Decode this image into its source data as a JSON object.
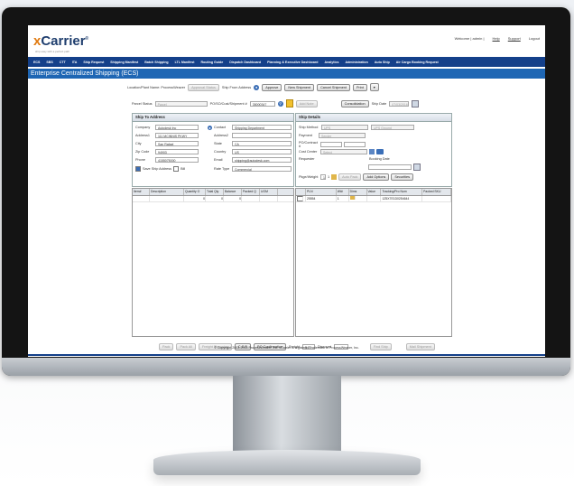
{
  "header": {
    "brand": "xCarrier",
    "reg": "®",
    "tagline": "ship easy with a perfect path",
    "links": [
      "Welcome | admin |",
      "Help",
      "Support",
      "Logout"
    ]
  },
  "nav": [
    "ECS",
    "SBS",
    "CTT",
    "ITA",
    "Ship Request",
    "Shipping Manifest",
    "Batch Shipping",
    "LTL Manifest",
    "Routing Guide",
    "Dispatch Dashboard",
    "Planning & Executive Dashboard",
    "Analytics",
    "Administration",
    "Auto Ship",
    "Air Cargo Booking Request"
  ],
  "page_title": "Enterprise Centralized Shipping (ECS)",
  "toolbar": {
    "location_label": "Location/Plant Name: ProcessWeaver",
    "approval_status": "Approval Status",
    "ship_from_label": "Ship From Address",
    "approve": "Approve",
    "new_shipment": "New Shipment",
    "cancel_shipment": "Cancel Shipment",
    "print": "Print"
  },
  "search_row": {
    "parcel_status_label": "Parcel Status",
    "parcel_status_value": "Parcel",
    "po_label": "PO/SO/Cust/Shipment #",
    "po_value": "35000347",
    "add_note": "Add Note",
    "consolidation": "Consolidation",
    "ship_date_label": "Ship Date",
    "ship_date_value": "07/03/2016"
  },
  "ship_to": {
    "title": "Ship To Address",
    "company_label": "Company",
    "company": "Autodesk Inc",
    "contact_label": "Contact",
    "contact": "Shipping Department",
    "address1_label": "Address1",
    "address1": "111 MCINNIS PKWY",
    "address2_label": "Address2",
    "city_label": "City",
    "city": "San Rafael",
    "state_label": "State",
    "state": "CA",
    "zip_label": "Zip Code",
    "zip": "94903",
    "country_label": "Country",
    "country": "US",
    "phone_label": "Phone",
    "phone": "4155075000",
    "email_label": "Email",
    "email": "shipping@autodesk.com",
    "save_label": "Save Ship Address",
    "bill_label": "Bill",
    "rate_type_label": "Rate Type",
    "rate_type": "Commercial"
  },
  "ship_details": {
    "title": "Ship Details",
    "ship_method_label": "Ship Method",
    "ship_method": "UPS",
    "ship_via": "UPS Ground",
    "payment_label": "Payment",
    "payment": "Sender",
    "po_contract_label": "PO/Contract #",
    "cost_center_label": "Cost Center",
    "cost_center": "Select",
    "requester_label": "Requester",
    "booking_label": "Booking Date",
    "pkgs_label": "Pkge/Weight",
    "pkgs": "1",
    "of": "1",
    "auto_pack": "Auto Pack",
    "add_options": "Add Options",
    "securities": "Securities"
  },
  "items_grid": {
    "columns": [
      "Item#",
      "Description",
      "Quantity O",
      "Total Qty",
      "Balance",
      "Packed Q",
      "UOM"
    ],
    "rows": [
      [
        "",
        "",
        "0",
        "0",
        "0",
        "",
        ""
      ]
    ]
  },
  "pkg_grid": {
    "columns": [
      "",
      "PLN",
      "Wt#",
      "Dims",
      "Value",
      "Tracking/Pro Num",
      "Packed SKU"
    ],
    "rows": [
      [
        "",
        "25554",
        "1",
        "",
        "",
        "1Z5X7E1D0254644",
        ""
      ]
    ]
  },
  "bottom": {
    "buttons": [
      "Pack",
      "Pack All",
      "Freight Shopping",
      "C.S.R",
      "PO Confirmation"
    ],
    "freight_label": "Freight",
    "freight_value": "$.77",
    "discount_label": "Discount",
    "find_ship": "Find Ship",
    "mail_shipment": "Mail Shipment"
  },
  "footer": "© Copyright 2003-2016 ProcessWeaver, Inc. xCarrier is registered trademark of ProcessWeaver, Inc."
}
